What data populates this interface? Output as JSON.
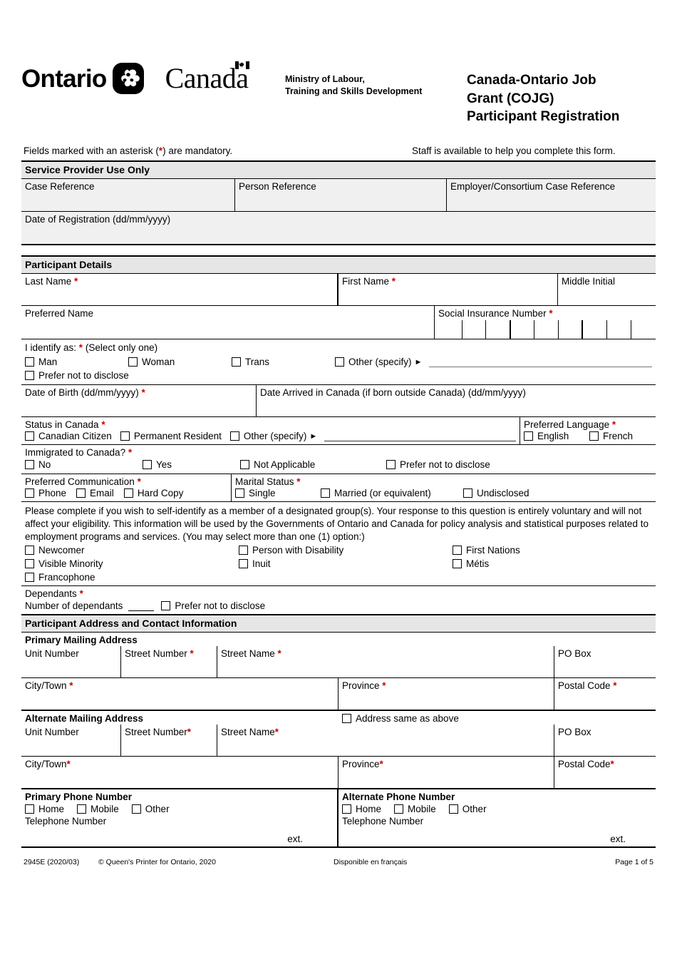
{
  "header": {
    "ontario_wordmark": "Ontario",
    "canada_wordmark": "Canada",
    "ministry_line1": "Ministry of Labour,",
    "ministry_line2": "Training and Skills Development",
    "form_title_line1": "Canada-Ontario Job",
    "form_title_line2": "Grant (COJG)",
    "form_title_line3": "Participant Registration"
  },
  "notices": {
    "mandatory": "Fields marked with an asterisk (*) are mandatory.",
    "staff_help": "Staff is available to help you complete this form."
  },
  "service_provider": {
    "band": "Service Provider Use Only",
    "case_reference": "Case Reference",
    "person_reference": "Person Reference",
    "employer_case_reference": "Employer/Consortium Case Reference",
    "date_of_registration": "Date of Registration (dd/mm/yyyy)"
  },
  "participant_details": {
    "band": "Participant Details",
    "last_name": "Last Name",
    "first_name": "First Name",
    "middle_initial": "Middle Initial",
    "preferred_name": "Preferred Name",
    "sin": "Social Insurance Number",
    "sin_cells": 9,
    "identify_as": "I identify as:",
    "identify_hint": "(Select only one)",
    "identify_options": [
      "Man",
      "Woman",
      "Trans",
      "Other (specify)"
    ],
    "identify_prefer_not": "Prefer not to disclose",
    "date_of_birth": "Date of Birth (dd/mm/yyyy)",
    "date_arrived": "Date Arrived in Canada (if born outside Canada) (dd/mm/yyyy)",
    "status_in_canada": "Status in Canada",
    "status_options": [
      "Canadian Citizen",
      "Permanent Resident",
      "Other (specify)"
    ],
    "preferred_language": "Preferred Language",
    "language_options": [
      "English",
      "French"
    ],
    "immigrated": "Immigrated to Canada?",
    "immigrated_options": [
      "No",
      "Yes",
      "Not Applicable",
      "Prefer not to disclose"
    ],
    "preferred_communication": "Preferred Communication",
    "communication_options": [
      "Phone",
      "Email",
      "Hard Copy"
    ],
    "marital_status": "Marital Status",
    "marital_options": [
      "Single",
      "Married (or equivalent)",
      "Undisclosed"
    ],
    "self_identify_paragraph": "Please complete if you wish to self-identify as a member of a designated group(s). Your response to this question is entirely voluntary and will not affect your eligibility. This information will be used by the Governments of Ontario and Canada for policy analysis and statistical purposes related to employment programs and services. (You may select more than one (1) option:)",
    "designated_col1": [
      "Newcomer",
      "Visible Minority",
      "Francophone"
    ],
    "designated_col2": [
      "Person with Disability",
      "Inuit"
    ],
    "designated_col3": [
      "First Nations",
      "Métis"
    ],
    "dependants": "Dependants",
    "number_of_dependants": "Number of dependants",
    "dependants_prefer_not": "Prefer not to disclose"
  },
  "address": {
    "band": "Participant Address and Contact Information",
    "primary_heading": "Primary Mailing Address",
    "alternate_heading": "Alternate Mailing Address",
    "same_as_above": "Address same as above",
    "primary": {
      "unit_number": "Unit Number",
      "street_number": "Street Number",
      "street_number_req": " *",
      "street_name": "Street Name",
      "street_name_req": " *",
      "po_box": "PO Box",
      "city_town": "City/Town",
      "city_town_req": " *",
      "province": "Province",
      "province_req": " *",
      "postal_code": "Postal Code",
      "postal_code_req": " *"
    },
    "alternate": {
      "unit_number": "Unit Number",
      "street_number": "Street Number",
      "street_number_req": "*",
      "street_name": "Street Name",
      "street_name_req": "*",
      "po_box": "PO Box",
      "city_town": "City/Town",
      "city_town_req": "*",
      "province": "Province",
      "province_req": "*",
      "postal_code": "Postal Code",
      "postal_code_req": "*"
    },
    "primary_phone_heading": "Primary Phone Number",
    "alternate_phone_heading": "Alternate Phone Number",
    "phone_options": [
      "Home",
      "Mobile",
      "Other"
    ],
    "telephone_number": "Telephone Number",
    "ext": "ext."
  },
  "footer": {
    "form_code": "2945E (2020/03)",
    "copyright": "© Queen's Printer for Ontario, 2020",
    "french": "Disponible en français",
    "page": "Page 1 of 5"
  },
  "colors": {
    "required_asterisk": "#cc0000",
    "band_background": "#e6e6e6",
    "readonly_background": "#f0f0f0",
    "rule": "#000000"
  }
}
